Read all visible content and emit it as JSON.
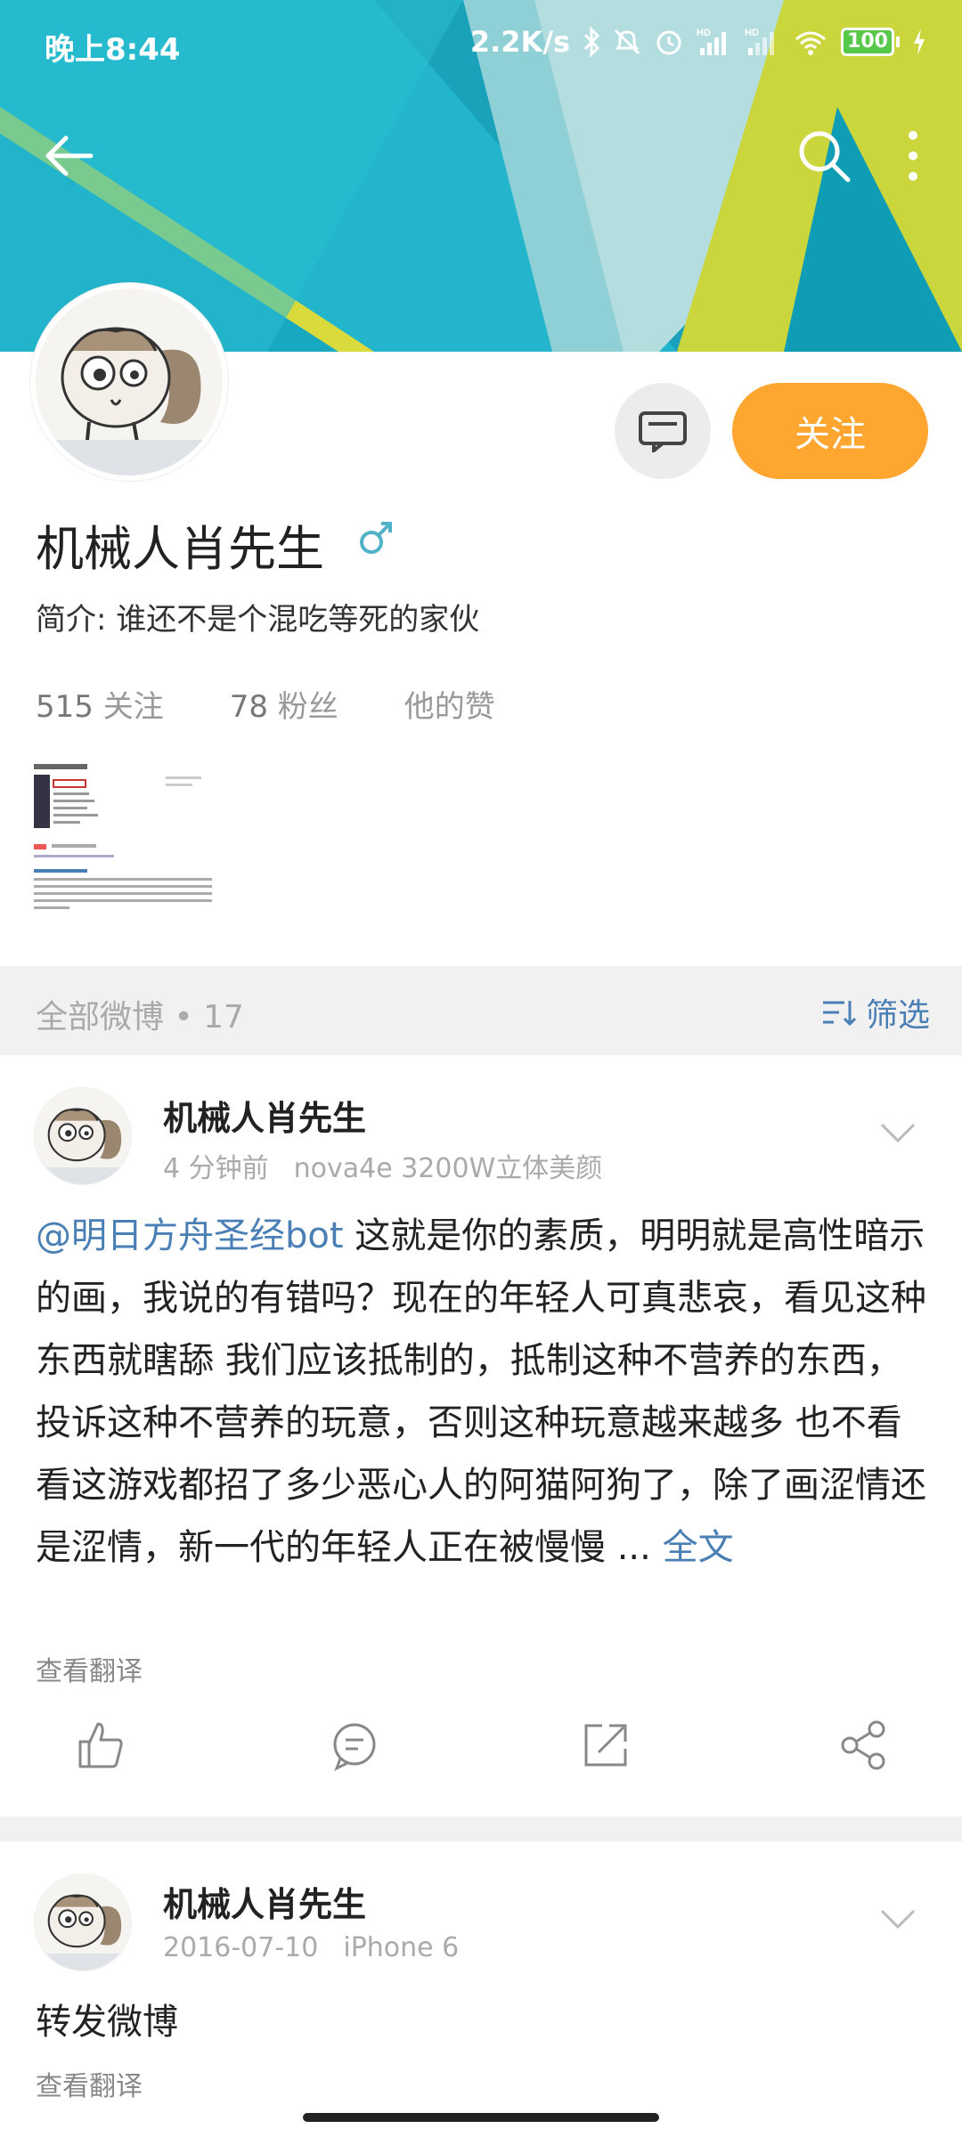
{
  "status": {
    "time": "晚上8:44",
    "speed": "2.2K/s",
    "battery": "100",
    "icons": [
      "bluetooth-icon",
      "mute-icon",
      "alarm-icon",
      "signal-hd-icon",
      "signal-hd-icon",
      "wifi-icon",
      "battery-icon",
      "charging-icon"
    ]
  },
  "nav": {
    "back": "back-arrow-icon",
    "search": "search-icon",
    "more": "more-vertical-icon"
  },
  "profile": {
    "name": "机械人肖先生",
    "gender_icon": "male-icon",
    "bio_label": "简介: ",
    "bio_text": "谁还不是个混吃等死的家伙",
    "follow_label": "关注",
    "message_icon": "message-icon",
    "stats": [
      {
        "num": "515",
        "label": " 关注"
      },
      {
        "num": "78",
        "label": " 粉丝"
      },
      {
        "num": "",
        "label": "他的赞"
      }
    ]
  },
  "feed": {
    "title": "全部微博 • 17",
    "filter_label": "筛选"
  },
  "posts": [
    {
      "author": "机械人肖先生",
      "time": "4 分钟前",
      "device": "nova4e 3200W立体美颜",
      "mention": "@明日方舟圣经bot",
      "text": " 这就是你的素质，明明就是高性暗示的画，我说的有错吗？现在的年轻人可真悲哀，看见这种东西就瞎舔 我们应该抵制的，抵制这种不营养的东西，投诉这种不营养的玩意，否则这种玩意越来越多 也不看看这游戏都招了多少恶心人的阿猫阿狗了，除了画涩情还是涩情，新一代的年轻人正在被慢慢 ... ",
      "fulltext": "全文",
      "translate": "查看翻译"
    },
    {
      "author": "机械人肖先生",
      "time": "2016-07-10",
      "device": "iPhone 6",
      "text": "转发微博",
      "translate": "查看翻译"
    }
  ],
  "colors": {
    "accent": "#ffa630",
    "link": "#4a7fb5",
    "banner_teal": "#1fb3c9",
    "banner_yellow": "#d6d83a"
  }
}
